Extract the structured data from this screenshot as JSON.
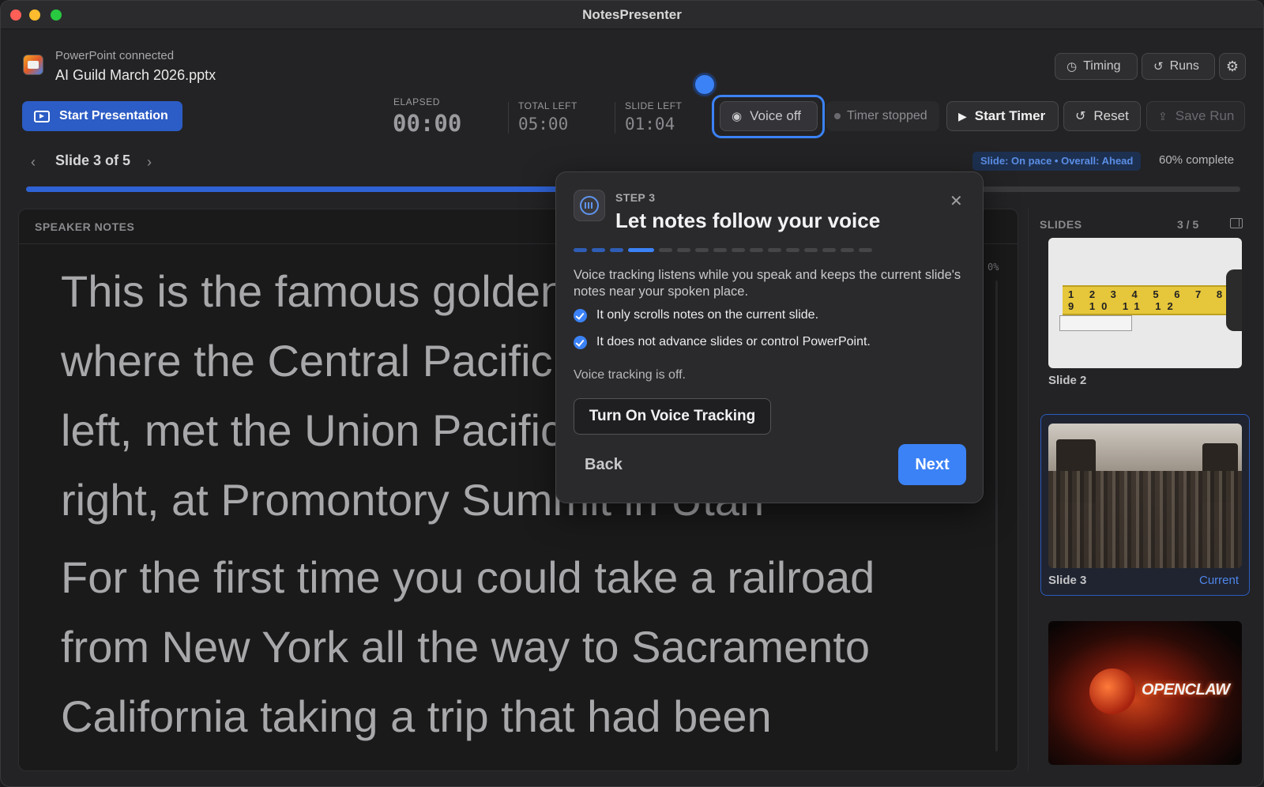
{
  "window": {
    "title": "NotesPresenter"
  },
  "header": {
    "connection_status": "PowerPoint connected",
    "file_name": "AI Guild March 2026.pptx",
    "timing_label": "Timing",
    "runs_label": "Runs"
  },
  "toolbar": {
    "start_presentation_label": "Start Presentation",
    "elapsed_label": "ELAPSED",
    "elapsed_value": "00:00",
    "total_left_label": "TOTAL LEFT",
    "total_left_value": "05:00",
    "slide_left_label": "SLIDE LEFT",
    "slide_left_value": "01:04",
    "voice_label": "Voice off",
    "timer_status": "Timer stopped",
    "start_timer_label": "Start Timer",
    "reset_label": "Reset",
    "save_run_label": "Save Run"
  },
  "navigation": {
    "slide_counter": "Slide 3 of 5",
    "pace_status": "Slide: On pace • Overall: Ahead",
    "complete_label": "60% complete",
    "progress": 0.6
  },
  "notes": {
    "title": "SPEAKER NOTES",
    "scroll_percent": "0%",
    "paragraphs": [
      "This is the famous golden spike photo where the Central Pacific, coming from the left, met the Union Pacific, coming from the right, at Promontory Summit in Utah",
      "For the first time you could take a railroad from New York all the way to Sacramento California taking a trip that had been"
    ]
  },
  "slides": {
    "title": "SLIDES",
    "index": "3 / 5",
    "items": [
      {
        "label": "Slide 2"
      },
      {
        "label": "Slide 3",
        "status": "Current"
      },
      {
        "label": "OPENCLAW"
      }
    ]
  },
  "tape_numbers": "1 2 3 4 5 6 7 8 9 10 11 12",
  "modal": {
    "step": "STEP 3",
    "title": "Let notes follow your voice",
    "description": "Voice tracking listens while you speak and keeps the current slide's notes near your spoken place.",
    "checks": [
      "It only scrolls notes on the current slide.",
      "It does not advance slides or control PowerPoint."
    ],
    "status": "Voice tracking is off.",
    "turn_on_label": "Turn On Voice Tracking",
    "back_label": "Back",
    "next_label": "Next",
    "current_step": 4,
    "total_steps": 16
  },
  "colors": {
    "accent": "#3b82f6",
    "primary_button": "#2c5cc5",
    "current_label": "#4f86ea"
  }
}
